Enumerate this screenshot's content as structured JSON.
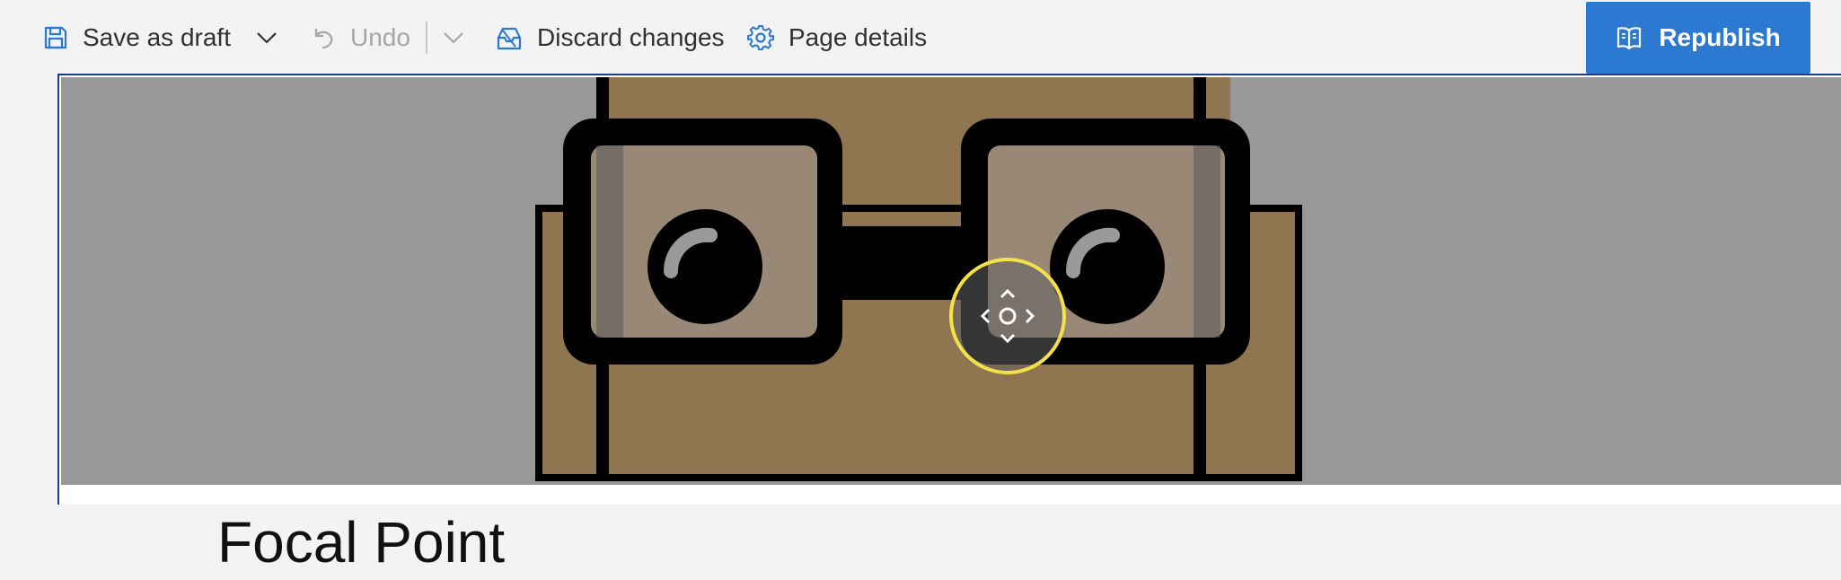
{
  "toolbar": {
    "save_as_draft": "Save as draft",
    "undo": "Undo",
    "discard_changes": "Discard changes",
    "page_details": "Page details",
    "republish": "Republish"
  },
  "page": {
    "title": "Focal Point"
  },
  "icons": {
    "save": "floppy-disk-icon",
    "dropdown": "chevron-down-icon",
    "undo": "undo-icon",
    "discard": "discard-icon",
    "page_details": "gear-icon",
    "republish": "book-icon",
    "focal_point": "move-focal-point-icon"
  },
  "colors": {
    "accent": "#2b79d0",
    "focal_ring": "#f3e14c",
    "canvas_border": "#1a3d8f",
    "banner_bg": "#989898",
    "glasses_skin": "#8f7650"
  }
}
